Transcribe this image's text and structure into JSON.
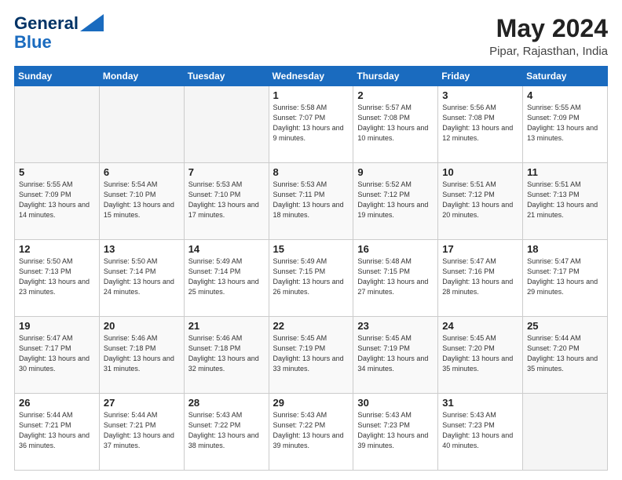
{
  "header": {
    "logo_line1": "General",
    "logo_line2": "Blue",
    "month_year": "May 2024",
    "location": "Pipar, Rajasthan, India"
  },
  "days_of_week": [
    "Sunday",
    "Monday",
    "Tuesday",
    "Wednesday",
    "Thursday",
    "Friday",
    "Saturday"
  ],
  "weeks": [
    [
      {
        "day": "",
        "empty": true
      },
      {
        "day": "",
        "empty": true
      },
      {
        "day": "",
        "empty": true
      },
      {
        "day": "1",
        "sunrise": "5:58 AM",
        "sunset": "7:07 PM",
        "daylight": "13 hours and 9 minutes."
      },
      {
        "day": "2",
        "sunrise": "5:57 AM",
        "sunset": "7:08 PM",
        "daylight": "13 hours and 10 minutes."
      },
      {
        "day": "3",
        "sunrise": "5:56 AM",
        "sunset": "7:08 PM",
        "daylight": "13 hours and 12 minutes."
      },
      {
        "day": "4",
        "sunrise": "5:55 AM",
        "sunset": "7:09 PM",
        "daylight": "13 hours and 13 minutes."
      }
    ],
    [
      {
        "day": "5",
        "sunrise": "5:55 AM",
        "sunset": "7:09 PM",
        "daylight": "13 hours and 14 minutes."
      },
      {
        "day": "6",
        "sunrise": "5:54 AM",
        "sunset": "7:10 PM",
        "daylight": "13 hours and 15 minutes."
      },
      {
        "day": "7",
        "sunrise": "5:53 AM",
        "sunset": "7:10 PM",
        "daylight": "13 hours and 17 minutes."
      },
      {
        "day": "8",
        "sunrise": "5:53 AM",
        "sunset": "7:11 PM",
        "daylight": "13 hours and 18 minutes."
      },
      {
        "day": "9",
        "sunrise": "5:52 AM",
        "sunset": "7:12 PM",
        "daylight": "13 hours and 19 minutes."
      },
      {
        "day": "10",
        "sunrise": "5:51 AM",
        "sunset": "7:12 PM",
        "daylight": "13 hours and 20 minutes."
      },
      {
        "day": "11",
        "sunrise": "5:51 AM",
        "sunset": "7:13 PM",
        "daylight": "13 hours and 21 minutes."
      }
    ],
    [
      {
        "day": "12",
        "sunrise": "5:50 AM",
        "sunset": "7:13 PM",
        "daylight": "13 hours and 23 minutes."
      },
      {
        "day": "13",
        "sunrise": "5:50 AM",
        "sunset": "7:14 PM",
        "daylight": "13 hours and 24 minutes."
      },
      {
        "day": "14",
        "sunrise": "5:49 AM",
        "sunset": "7:14 PM",
        "daylight": "13 hours and 25 minutes."
      },
      {
        "day": "15",
        "sunrise": "5:49 AM",
        "sunset": "7:15 PM",
        "daylight": "13 hours and 26 minutes."
      },
      {
        "day": "16",
        "sunrise": "5:48 AM",
        "sunset": "7:15 PM",
        "daylight": "13 hours and 27 minutes."
      },
      {
        "day": "17",
        "sunrise": "5:47 AM",
        "sunset": "7:16 PM",
        "daylight": "13 hours and 28 minutes."
      },
      {
        "day": "18",
        "sunrise": "5:47 AM",
        "sunset": "7:17 PM",
        "daylight": "13 hours and 29 minutes."
      }
    ],
    [
      {
        "day": "19",
        "sunrise": "5:47 AM",
        "sunset": "7:17 PM",
        "daylight": "13 hours and 30 minutes."
      },
      {
        "day": "20",
        "sunrise": "5:46 AM",
        "sunset": "7:18 PM",
        "daylight": "13 hours and 31 minutes."
      },
      {
        "day": "21",
        "sunrise": "5:46 AM",
        "sunset": "7:18 PM",
        "daylight": "13 hours and 32 minutes."
      },
      {
        "day": "22",
        "sunrise": "5:45 AM",
        "sunset": "7:19 PM",
        "daylight": "13 hours and 33 minutes."
      },
      {
        "day": "23",
        "sunrise": "5:45 AM",
        "sunset": "7:19 PM",
        "daylight": "13 hours and 34 minutes."
      },
      {
        "day": "24",
        "sunrise": "5:45 AM",
        "sunset": "7:20 PM",
        "daylight": "13 hours and 35 minutes."
      },
      {
        "day": "25",
        "sunrise": "5:44 AM",
        "sunset": "7:20 PM",
        "daylight": "13 hours and 35 minutes."
      }
    ],
    [
      {
        "day": "26",
        "sunrise": "5:44 AM",
        "sunset": "7:21 PM",
        "daylight": "13 hours and 36 minutes."
      },
      {
        "day": "27",
        "sunrise": "5:44 AM",
        "sunset": "7:21 PM",
        "daylight": "13 hours and 37 minutes."
      },
      {
        "day": "28",
        "sunrise": "5:43 AM",
        "sunset": "7:22 PM",
        "daylight": "13 hours and 38 minutes."
      },
      {
        "day": "29",
        "sunrise": "5:43 AM",
        "sunset": "7:22 PM",
        "daylight": "13 hours and 39 minutes."
      },
      {
        "day": "30",
        "sunrise": "5:43 AM",
        "sunset": "7:23 PM",
        "daylight": "13 hours and 39 minutes."
      },
      {
        "day": "31",
        "sunrise": "5:43 AM",
        "sunset": "7:23 PM",
        "daylight": "13 hours and 40 minutes."
      },
      {
        "day": "",
        "empty": true
      }
    ]
  ]
}
